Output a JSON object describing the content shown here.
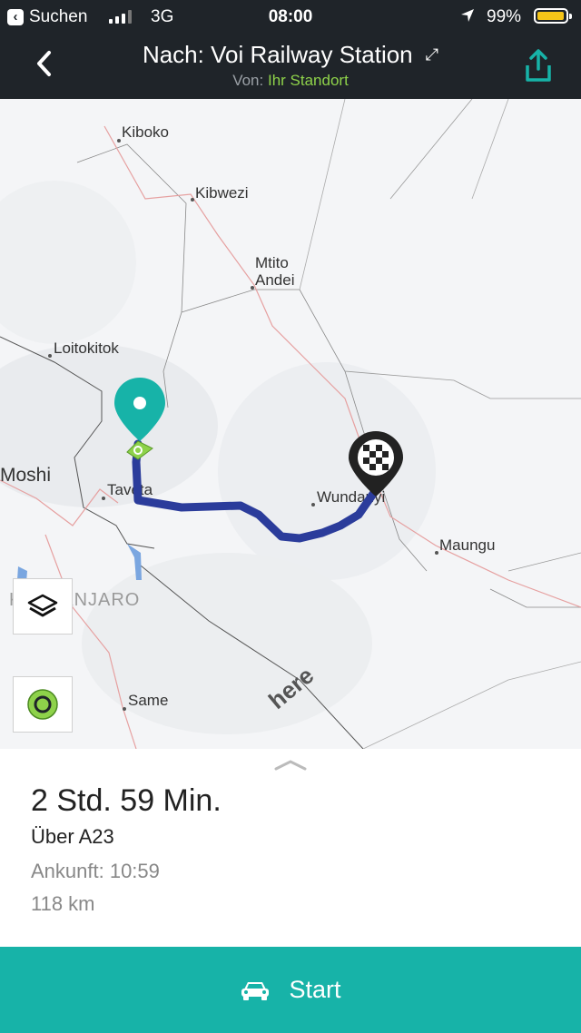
{
  "status_bar": {
    "back_app": "Suchen",
    "network": "3G",
    "time": "08:00",
    "battery": "99%",
    "battery_color": "#f5c518"
  },
  "header": {
    "title": "Nach: Voi Railway Station",
    "from_prefix": "Von:",
    "from_value": "Ihr Standort",
    "expand_icon": "expand-icon",
    "share_icon": "share-icon",
    "accent_color": "#8ed24a"
  },
  "map": {
    "places": [
      "Kiboko",
      "Kibwezi",
      "Mtito",
      "Andei",
      "Loitokitok",
      "Moshi",
      "Taveta",
      "Wundanyi",
      "Maungu",
      "KILIMANJARO",
      "Same"
    ],
    "logo": "here",
    "route_color": "#2b3c9b",
    "pin_color": "#17b3a8",
    "controls": [
      "layers-icon",
      "locate-icon"
    ]
  },
  "summary": {
    "duration": "2 Std. 59 Min.",
    "via": "Über A23",
    "arrival": "Ankunft: 10:59",
    "distance": "118 km"
  },
  "start_button": {
    "label": "Start",
    "icon": "car-icon",
    "color": "#17b3a8"
  }
}
